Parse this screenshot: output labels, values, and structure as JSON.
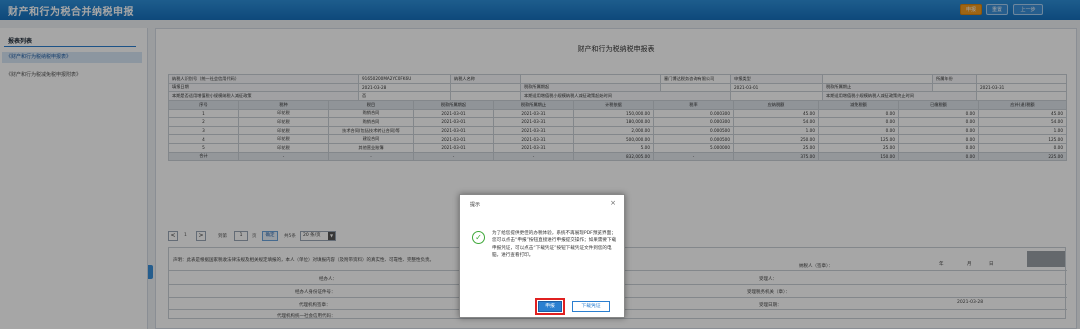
{
  "header": {
    "title": "财产和行为税合并纳税申报",
    "buttons": [
      "申报",
      "重置",
      "上一步"
    ]
  },
  "sidebar": {
    "title": "报表列表",
    "items": [
      "《财产和行为税纳税申报表》",
      "《财产和行为税减免税申报附表》"
    ]
  },
  "report": {
    "title": "财产和行为税纳税申报表",
    "info_rows": [
      [
        "纳税人识别号（统一社会信用代码）",
        "91650200MA2YC0FK6U",
        "纳税人名称",
        "",
        "塞门博达税务咨询有限公司",
        "申报类型",
        "",
        "所属年份",
        ""
      ],
      [
        "填报日期",
        "2021-03-28",
        "",
        "税款所属期起",
        "",
        "2021-03-01",
        "税款所属期止",
        "",
        "2021-03-31"
      ],
      [
        "本期是否适用增值税小规模纳税人减征政策",
        "否",
        "",
        "本期适用增值税小规模纳税人减征政策起始时间",
        "",
        "",
        "本期适用增值税小规模纳税人减征政策终止时间",
        "",
        ""
      ]
    ],
    "columns": [
      "序号",
      "税种",
      "税目",
      "税款所属期起",
      "税款所属期止",
      "计税依据",
      "税率",
      "应纳税额",
      "减免税额",
      "已缴税额",
      "应补(退)税额"
    ],
    "rows": [
      [
        "1",
        "印花税",
        "购销合同",
        "2021-03-01",
        "2021-03-31",
        "150,000.00",
        "0.000300",
        "45.00",
        "0.00",
        "0.00",
        "45.00"
      ],
      [
        "2",
        "印花税",
        "购销合同",
        "2021-03-01",
        "2021-03-31",
        "180,000.00",
        "0.000300",
        "54.00",
        "0.00",
        "0.00",
        "54.00"
      ],
      [
        "3",
        "印花税",
        "技术合同(包括技术转让合同)等",
        "2021-03-01",
        "2021-03-31",
        "2,000.00",
        "0.000500",
        "1.00",
        "0.00",
        "0.00",
        "1.00"
      ],
      [
        "4",
        "印花税",
        "建设合同",
        "2021-03-01",
        "2021-03-31",
        "500,000.00",
        "0.000500",
        "250.00",
        "125.00",
        "0.00",
        "125.00"
      ],
      [
        "5",
        "印花税",
        "其他营业账簿",
        "2021-03-01",
        "2021-03-31",
        "5.00",
        "5.000000",
        "25.00",
        "25.00",
        "0.00",
        "0.00"
      ]
    ],
    "total": [
      "合计",
      "-",
      "-",
      "-",
      "-",
      "832,005.00",
      "-",
      "375.00",
      "150.00",
      "0.00",
      "225.00"
    ]
  },
  "pager": {
    "prev": "<",
    "page": "1",
    "next": ">",
    "goto_label": "到第",
    "page_input": "1",
    "page_unit": "页",
    "confirm": "确定",
    "total": "共5条",
    "page_size": "20 条/页"
  },
  "declaration": {
    "statement": "声明：此表是根据国家税收法律法规及相关规定填报的，本人（单位）对填报内容（及附带资料）的真实性、可靠性、完整性负责。",
    "taxpayer_sign": "纳税人（签章）：",
    "year": "年",
    "month": "月",
    "day": "日",
    "agent": "经办人：",
    "agent_id": "经办人身份证件号：",
    "agency": "代理机构签章：",
    "agency_code": "代理机构统一社会信用代码：",
    "receiver": "受理人：",
    "receiver_org": "受理税务机关（章）：",
    "receive_date_label": "受理日期：",
    "receive_date": "2021-03-28"
  },
  "modal": {
    "title": "提示",
    "close": "×",
    "message": "为了给您提供更佳的办税体验，系统不再展现PDF预览界面；您可以点击“申报”按钮直接进行申报提交操作；如果需要下载申报凭证，可以点击“下载凭证”按钮下载凭证文件到您的电脑，进行查看打印。",
    "primary": "申报",
    "secondary": "下载凭证"
  },
  "colors": {
    "brand": "#1670bd",
    "accent": "#f39c1f",
    "success": "#3fa83a",
    "highlight": "#e02020"
  }
}
